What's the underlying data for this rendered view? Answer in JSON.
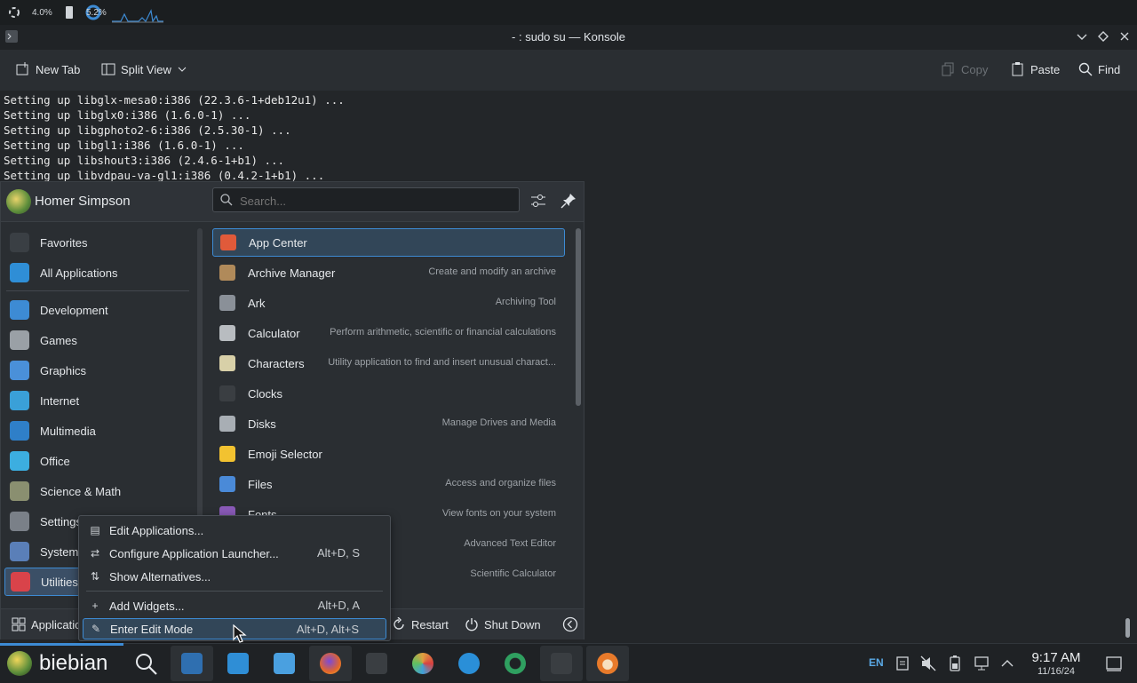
{
  "top_widgets": {
    "cpu_percent": "4.0%",
    "mem_percent": "5.2%"
  },
  "window": {
    "title": "- : sudo su — Konsole"
  },
  "toolbar": {
    "new_tab": "New Tab",
    "split_view": "Split View",
    "copy": "Copy",
    "paste": "Paste",
    "find": "Find"
  },
  "terminal": {
    "lines": [
      "Setting up libglx-mesa0:i386 (22.3.6-1+deb12u1) ...",
      "Setting up libglx0:i386 (1.6.0-1) ...",
      "Setting up libgphoto2-6:i386 (2.5.30-1) ...",
      "Setting up libgl1:i386 (1.6.0-1) ...",
      "Setting up libshout3:i386 (2.4.6-1+b1) ...",
      "Setting up libvdpau-va-gl1:i386 (0.4.2-1+b1) ..."
    ]
  },
  "launcher": {
    "user_name": "Homer Simpson",
    "search_placeholder": "Search...",
    "categories": [
      {
        "label": "Favorites",
        "color": "#3a3f44"
      },
      {
        "label": "All Applications",
        "color": "#2f8ed6"
      },
      {
        "label": "Development",
        "color": "#3d8bd4"
      },
      {
        "label": "Games",
        "color": "#9aa0a6"
      },
      {
        "label": "Graphics",
        "color": "#4a90d9"
      },
      {
        "label": "Internet",
        "color": "#3aa0d8"
      },
      {
        "label": "Multimedia",
        "color": "#2f7fc8"
      },
      {
        "label": "Office",
        "color": "#3caee0"
      },
      {
        "label": "Science & Math",
        "color": "#8a8f70"
      },
      {
        "label": "Settings",
        "color": "#7a8088"
      },
      {
        "label": "System",
        "color": "#5a7fb8"
      },
      {
        "label": "Utilities",
        "color": "#d9434a"
      }
    ],
    "apps": [
      {
        "name": "App Center",
        "desc": "",
        "color": "#e05a3a"
      },
      {
        "name": "Archive Manager",
        "desc": "Create and modify an archive",
        "color": "#b08a5a"
      },
      {
        "name": "Ark",
        "desc": "Archiving Tool",
        "color": "#8a9098"
      },
      {
        "name": "Calculator",
        "desc": "Perform arithmetic, scientific or financial calculations",
        "color": "#b8bcc0"
      },
      {
        "name": "Characters",
        "desc": "Utility application to find and insert unusual charact...",
        "color": "#d8d0a8"
      },
      {
        "name": "Clocks",
        "desc": "",
        "color": "#3a3e42"
      },
      {
        "name": "Disks",
        "desc": "Manage Drives and Media",
        "color": "#a8aeb4"
      },
      {
        "name": "Emoji Selector",
        "desc": "",
        "color": "#f2c230"
      },
      {
        "name": "Files",
        "desc": "Access and organize files",
        "color": "#4a8ad8"
      },
      {
        "name": "Fonts",
        "desc": "View fonts on your system",
        "color": "#8a5ab8"
      },
      {
        "name": "",
        "desc": "Advanced Text Editor",
        "color": "#2a2e32"
      },
      {
        "name": "",
        "desc": "Scientific Calculator",
        "color": "#2a2e32"
      }
    ],
    "footer": {
      "applications": "Applications",
      "restart": "Restart",
      "shut_down": "Shut Down"
    }
  },
  "context_menu": {
    "items": [
      {
        "label": "Edit Applications...",
        "shortcut": ""
      },
      {
        "label": "Configure Application Launcher...",
        "shortcut": "Alt+D, S"
      },
      {
        "label": "Show Alternatives...",
        "shortcut": ""
      },
      {
        "label": "Add Widgets...",
        "shortcut": "Alt+D, A"
      },
      {
        "label": "Enter Edit Mode",
        "shortcut": "Alt+D, Alt+S"
      }
    ]
  },
  "taskbar": {
    "brand": "biebian",
    "language": "EN",
    "time": "9:17 AM",
    "date": "11/16/24",
    "tasks": [
      {
        "icon": "system-settings-icon",
        "color": "#2f6fb0"
      },
      {
        "icon": "store-icon",
        "color": "#2f8ed6"
      },
      {
        "icon": "folder-icon",
        "color": "#4aa0e0"
      },
      {
        "icon": "firefox-icon",
        "color": "#e2662a"
      },
      {
        "icon": "lock-icon",
        "color": "#3a3e42"
      },
      {
        "icon": "pinwheel-icon",
        "color": "#e0a040"
      },
      {
        "icon": "browser-icon",
        "color": "#2a8fd8"
      },
      {
        "icon": "disk-util-icon",
        "color": "#2fa060"
      },
      {
        "icon": "terminal-icon",
        "color": "#3a3e42"
      },
      {
        "icon": "panda-icon",
        "color": "#e87a2a"
      }
    ]
  }
}
